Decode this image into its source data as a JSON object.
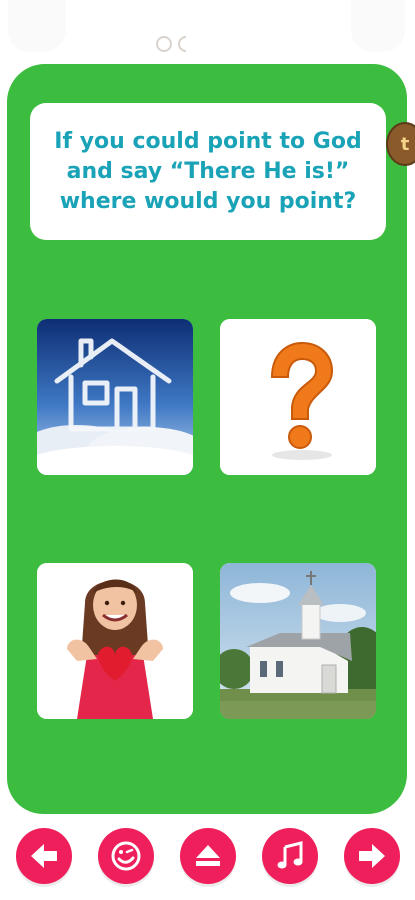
{
  "question": {
    "text": "If you could point to God and say “There He is!” where would you point?"
  },
  "badge": {
    "glyph": "t"
  },
  "pager": {
    "total": 2,
    "current": 1
  },
  "answers": [
    {
      "id": "cloud-house",
      "icon": "cloud-house-image"
    },
    {
      "id": "question-mark",
      "icon": "question-mark-image"
    },
    {
      "id": "girl-with-heart",
      "icon": "girl-heart-image"
    },
    {
      "id": "church",
      "icon": "church-image"
    }
  ],
  "toolbar": {
    "buttons": [
      {
        "id": "back",
        "icon": "arrow-left-icon"
      },
      {
        "id": "hint",
        "icon": "smiley-icon"
      },
      {
        "id": "eject",
        "icon": "eject-icon"
      },
      {
        "id": "music",
        "icon": "music-note-icon"
      },
      {
        "id": "next",
        "icon": "arrow-right-icon"
      }
    ]
  },
  "colors": {
    "board": "#3cbd3f",
    "question_text": "#1aa3b7",
    "toolbar_button": "#ee1f5a",
    "question_mark": "#f07a1a"
  }
}
